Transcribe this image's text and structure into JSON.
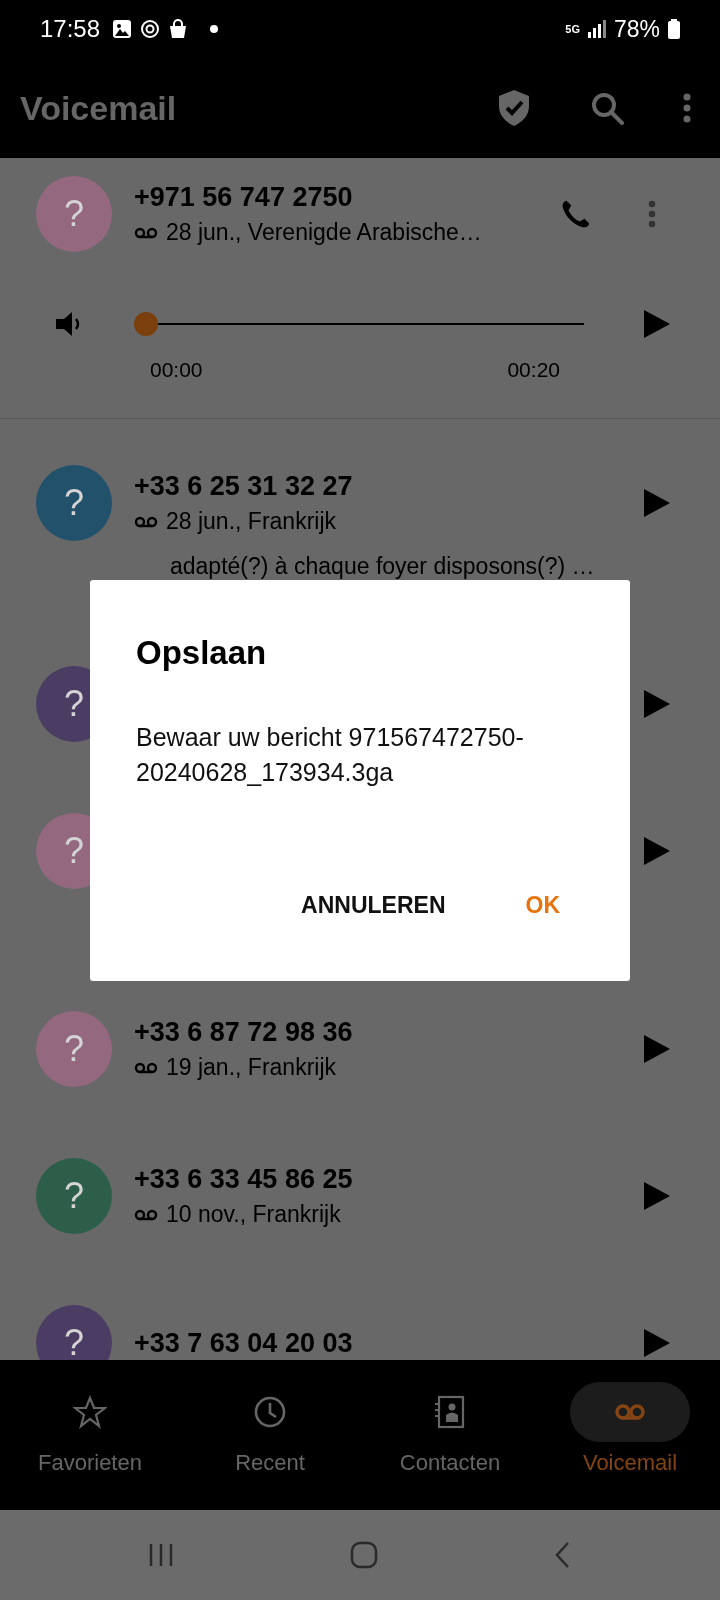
{
  "status_bar": {
    "time": "17:58",
    "network": "5G",
    "battery": "78%"
  },
  "app_bar": {
    "title": "Voicemail"
  },
  "voicemails": [
    {
      "avatar": "?",
      "number": "+971 56 747 2750",
      "detail": "28 jun., Verenigde Arabische…",
      "color": "#94687f",
      "expanded": true,
      "player": {
        "level": 0,
        "position": "00:00",
        "duration": "00:20"
      }
    },
    {
      "avatar": "?",
      "number": "+33 6 25 31 32 27",
      "detail": "28 jun., Frankrijk",
      "color": "#22516b",
      "expanded": false,
      "transcript": "adapté(?) à chaque foyer disposons(?) …"
    },
    {
      "avatar": "?",
      "color": "#4b3c63",
      "expanded": false
    },
    {
      "avatar": "?",
      "color": "#94687f",
      "expanded": false
    },
    {
      "avatar": "?",
      "number": "+33 6 87 72 98 36",
      "detail": "19 jan., Frankrijk",
      "color": "#94687f",
      "expanded": false
    },
    {
      "avatar": "?",
      "number": "+33 6 33 45 86 25",
      "detail": "10 nov., Frankrijk",
      "color": "#2c5e49",
      "expanded": false
    },
    {
      "avatar": "?",
      "number": "+33 7 63 04 20 03",
      "color": "#4b3c63",
      "expanded": false
    }
  ],
  "dialog": {
    "title": "Opslaan",
    "message": "Bewaar uw bericht 971567472750-20240628_173934.3ga",
    "buttons": [
      {
        "label": "ANNULEREN",
        "kind": "neutral"
      },
      {
        "label": "OK",
        "kind": "confirm"
      }
    ]
  },
  "bottom_nav": [
    {
      "label": "Favorieten",
      "selected": false
    },
    {
      "label": "Recent",
      "selected": false
    },
    {
      "label": "Contacten",
      "selected": false
    },
    {
      "label": "Voicemail",
      "selected": true
    }
  ]
}
